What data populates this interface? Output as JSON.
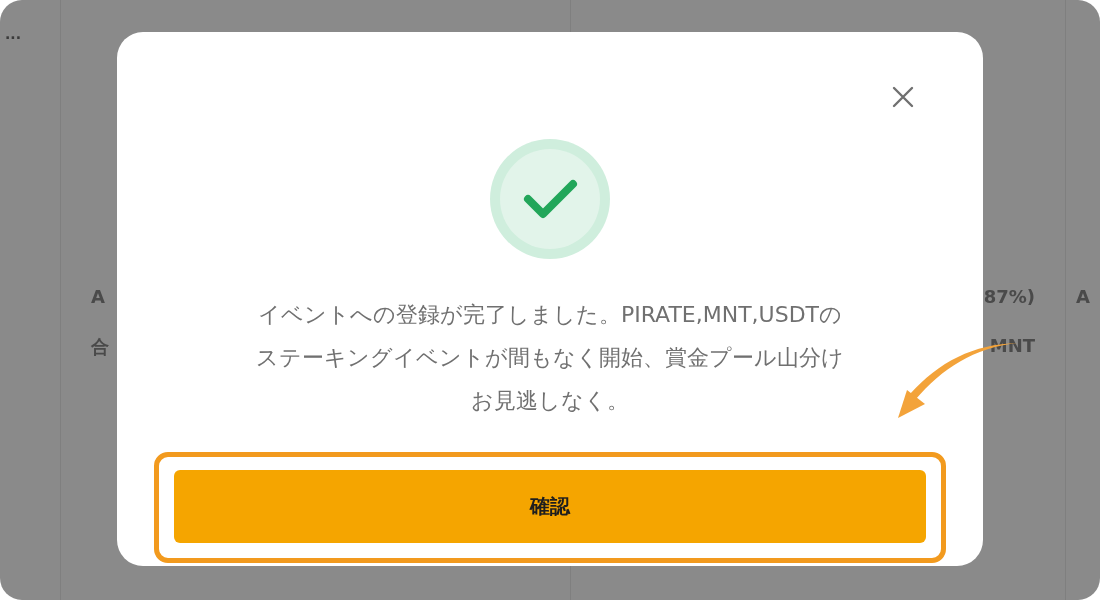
{
  "background": {
    "menu": "...",
    "cards": [
      {
        "label": "A",
        "sub": "合"
      },
      {
        "label": "87%)",
        "sub": "MNT"
      },
      {
        "label": "A"
      }
    ]
  },
  "dialog": {
    "message_lines": [
      "イベントへの登録が完了しました。PIRATE,MNT,USDTの",
      "ステーキングイベントが間もなく開始、賞金プール山分け",
      "お見逃しなく。"
    ],
    "confirm_button": "確認",
    "highlighted": true
  }
}
